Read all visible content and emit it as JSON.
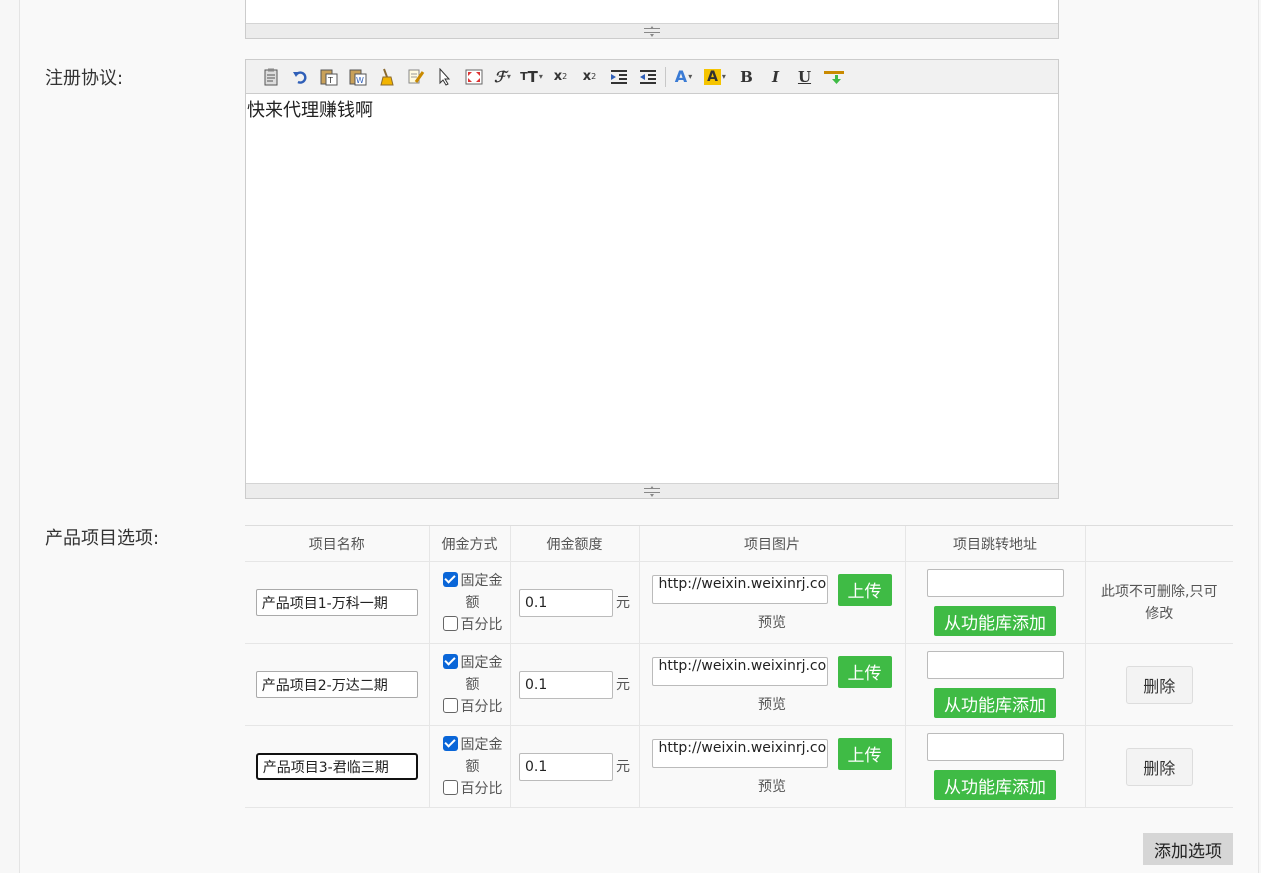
{
  "labels": {
    "agreement": "注册协议:",
    "product_options": "产品项目选项:"
  },
  "editor": {
    "content": "快来代理赚钱啊",
    "toolbar_icons": [
      "paste-icon",
      "undo-icon",
      "paste-text-icon",
      "paste-word-icon",
      "clear-format-icon",
      "format-brush-icon",
      "select-all-icon",
      "fullscreen-icon",
      "font-family-icon",
      "font-size-icon",
      "subscript-icon",
      "superscript-icon",
      "indent-icon",
      "outdent-icon",
      "font-color-icon",
      "highlight-icon",
      "bold-icon",
      "italic-icon",
      "underline-icon",
      "insert-hr-icon"
    ],
    "colors": {
      "font_color": "#3a7bd5",
      "highlight": "#f5c400",
      "insert_accent": "#3fbb45"
    }
  },
  "table": {
    "headers": [
      "项目名称",
      "佣金方式",
      "佣金额度",
      "项目图片",
      "项目跳转地址",
      ""
    ],
    "rows": [
      {
        "name": "产品项目1-万科一期",
        "fixed_label": "固定金",
        "fixed_label2": "额",
        "percent_label": "百分比",
        "fixed_checked": true,
        "percent_checked": false,
        "amount": "0.1",
        "unit": "元",
        "image_url": "http://weixin.weixinrj.co",
        "upload": "上传",
        "preview": "预览",
        "jump_url": "",
        "library": "从功能库添加",
        "action_note": "此项不可删除,只可",
        "action_note2": "修改"
      },
      {
        "name": "产品项目2-万达二期",
        "fixed_label": "固定金",
        "fixed_label2": "额",
        "percent_label": "百分比",
        "fixed_checked": true,
        "percent_checked": false,
        "amount": "0.1",
        "unit": "元",
        "image_url": "http://weixin.weixinrj.co",
        "upload": "上传",
        "preview": "预览",
        "jump_url": "",
        "library": "从功能库添加",
        "delete": "删除"
      },
      {
        "name": "产品项目3-君临三期",
        "fixed_label": "固定金",
        "fixed_label2": "额",
        "percent_label": "百分比",
        "fixed_checked": true,
        "percent_checked": false,
        "amount": "0.1",
        "unit": "元",
        "image_url": "http://weixin.weixinrj.co",
        "upload": "上传",
        "preview": "预览",
        "jump_url": "",
        "library": "从功能库添加",
        "delete": "删除"
      }
    ]
  },
  "add_option": "添加选项",
  "colors": {
    "green": "#3fbb45",
    "checkbox_blue": "#0a66d8"
  }
}
